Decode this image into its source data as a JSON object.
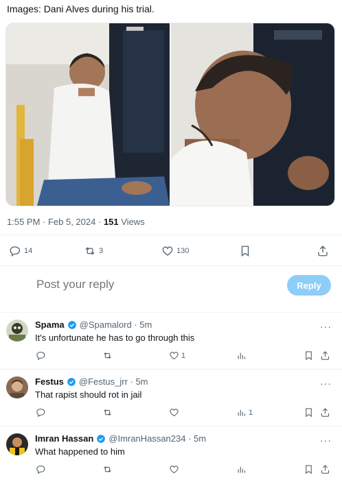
{
  "post": {
    "caption": "Images: Dani Alves during his trial.",
    "time": "1:55 PM · Feb 5, 2024 ·",
    "views_count": "151",
    "views_label": "Views",
    "counts": {
      "replies": "14",
      "reposts": "3",
      "likes": "130"
    }
  },
  "reply_box": {
    "placeholder": "Post your reply",
    "button": "Reply"
  },
  "replies": [
    {
      "name": "Spama",
      "handle": "@Spamalord · 5m",
      "verified": true,
      "text": "It's unfortunate he has to go through this",
      "likes": "1",
      "views": ""
    },
    {
      "name": "Festus",
      "handle": "@Festus_jrr · 5m",
      "verified": true,
      "text": "That rapist should rot in jail",
      "likes": "",
      "views": "1"
    },
    {
      "name": "Imran Hassan",
      "handle": "@ImranHassan234 · 5m",
      "verified": true,
      "text": "What happened to him",
      "likes": "",
      "views": ""
    }
  ],
  "colors": {
    "accent": "#1d9bf0",
    "reply_button": "#8ecdf8",
    "muted": "#536471"
  },
  "icons": [
    "reply-icon",
    "repost-icon",
    "like-icon",
    "bookmark-icon",
    "share-icon",
    "views-icon",
    "verified-icon",
    "more-icon"
  ]
}
